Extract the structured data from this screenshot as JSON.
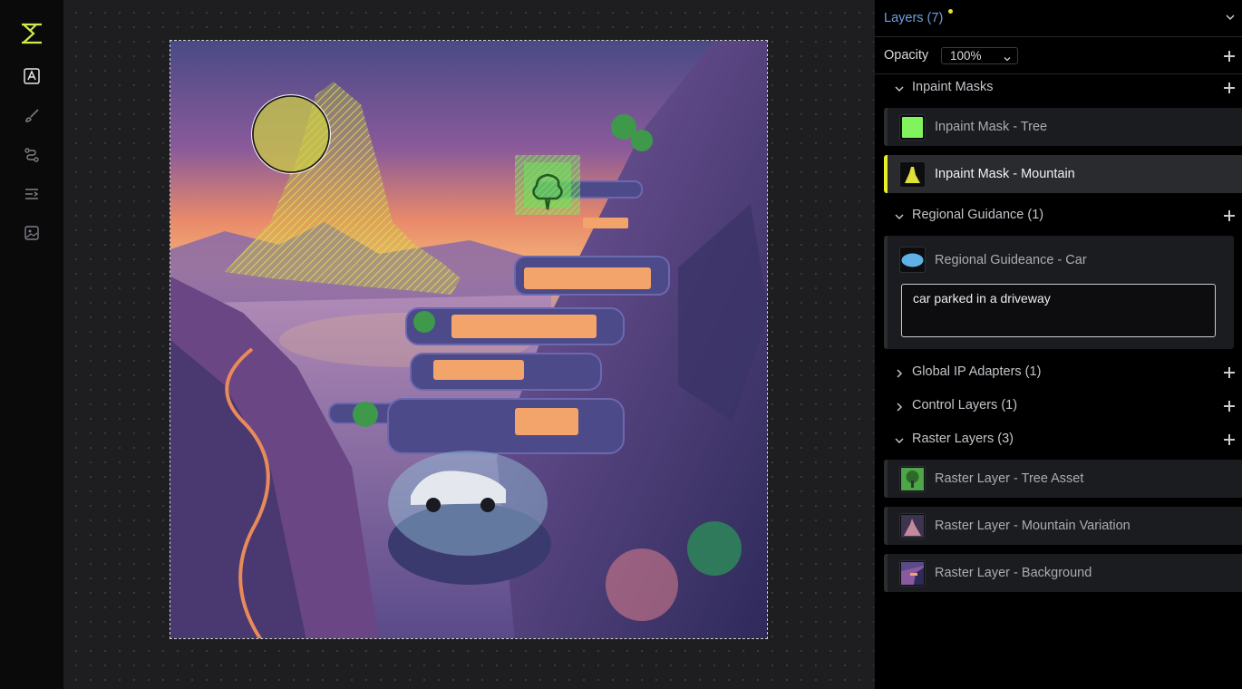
{
  "toolbar": {
    "logo": "invoke-logo-icon",
    "tools": [
      "text-tool-icon",
      "brush-icon",
      "nodes-icon",
      "list-icon",
      "image-icon"
    ]
  },
  "panel": {
    "title": "Layers (7)",
    "opacity": {
      "label": "Opacity",
      "value": "100%"
    },
    "groups": {
      "inpaint": "Inpaint Masks",
      "regional": "Regional Guidance (1)",
      "ip_adapters": "Global IP Adapters (1)",
      "control": "Control Layers (1)",
      "raster": "Raster Layers (3)"
    },
    "inpaint_layers": [
      "Inpaint Mask - Tree",
      "Inpaint Mask - Mountain"
    ],
    "regional_layer": {
      "name": "Regional Guideance - Car",
      "prompt": "car parked in a driveway"
    },
    "raster_layers": [
      "Raster Layer - Tree Asset",
      "Raster Layer - Mountain Variation",
      "Raster Layer - Background"
    ]
  },
  "colors": {
    "accent_blue": "#6da0e0",
    "selected_bar": "#e9ed2a",
    "mask_green": "#7ff45c",
    "mask_yellow": "#dfe03a",
    "guidance_blue": "#5fb1e6"
  }
}
